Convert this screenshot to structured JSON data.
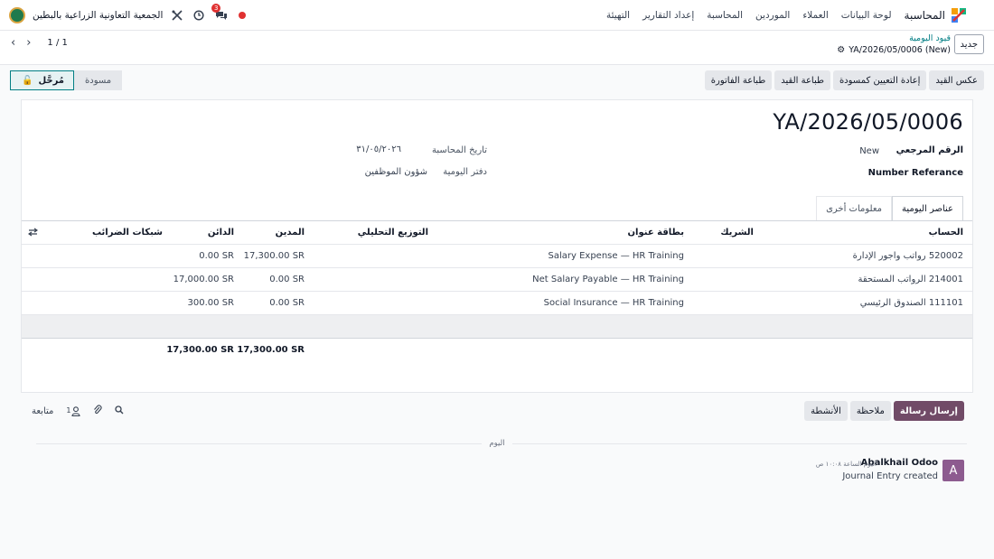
{
  "navbar": {
    "app_name": "المحاسبة",
    "menu": [
      "لوحة البيانات",
      "العملاء",
      "الموردين",
      "المحاسبة",
      "إعداد التقارير",
      "التهيئة"
    ],
    "company": "الجمعية التعاونية الزراعية بالبطين",
    "chat_count": "3"
  },
  "control": {
    "new_label": "جديد",
    "breadcrumb_parent": "قيود اليومية",
    "breadcrumb_current": "YA/2026/05/0006 (New)",
    "pager": "1 / 1"
  },
  "actions": [
    "عكس القيد",
    "إعادة التعيين كمسودة",
    "طباعة القيد",
    "طباعة الفاتورة"
  ],
  "status": {
    "posted": "مُرحَّل",
    "draft": "مسودة"
  },
  "form": {
    "name": "YA/2026/05/0006",
    "ref_label": "الرقم المرجعي",
    "ref_value": "New",
    "number_ref_label": "Number Referance",
    "date_label": "تاريخ المحاسبة",
    "date_value": "٣١/٠٥/٢٠٢٦",
    "journal_label": "دفتر اليومية",
    "journal_value": "شؤون الموظفين"
  },
  "tabs": [
    "عناصر اليومية",
    "معلومات أخرى"
  ],
  "table": {
    "headers": {
      "account": "الحساب",
      "partner": "الشريك",
      "label": "بطاقة عنوان",
      "analytic": "التوزيع التحليلي",
      "debit": "المدين",
      "credit": "الدائن",
      "tax": "شبكات الضرائب"
    },
    "rows": [
      {
        "account": "520002 رواتب واجور الإدارة",
        "label": "Salary Expense — HR Training",
        "debit": "17,300.00 SR",
        "credit": "0.00 SR"
      },
      {
        "account": "214001 الرواتب المستحقة",
        "label": "Net Salary Payable — HR Training",
        "debit": "0.00 SR",
        "credit": "17,000.00 SR"
      },
      {
        "account": "111101 الصندوق الرئيسي",
        "label": "Social Insurance — HR Training",
        "debit": "0.00 SR",
        "credit": "300.00 SR"
      }
    ],
    "total_debit": "17,300.00 SR",
    "total_credit": "17,300.00 SR"
  },
  "chatter": {
    "send": "إرسال رسالة",
    "note": "ملاحظة",
    "activities": "الأنشطة",
    "follow": "متابعة",
    "followers": "1",
    "day": "اليوم",
    "author": "Abalkhail Odoo",
    "avatar": "A",
    "date": "اليوم الساعة ١٠:٠٨ ص",
    "body": "Journal Entry created"
  }
}
